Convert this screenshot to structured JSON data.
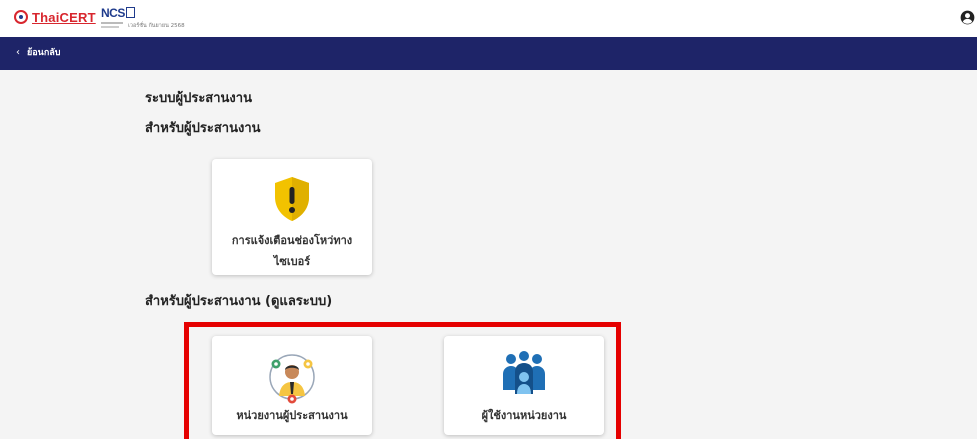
{
  "header": {
    "thaicert_logo_text": "ThaiCERT",
    "ncsa_logo_text": "NCS",
    "ncsa_sub_text": "เวอร์ชั่น กันยายน 2568"
  },
  "navbar": {
    "back_label": "ย้อนกลับ"
  },
  "main": {
    "page_title": "ระบบผู้ประสานงาน",
    "section_coordinator": "สำหรับผู้ประสานงาน",
    "section_admin": "สำหรับผู้ประสานงาน (ดูแลระบบ)",
    "cards": {
      "alert": {
        "line1": "การแจ้งเตือนช่องโหว่ทาง",
        "line2": "ไซเบอร์"
      },
      "agency": {
        "label": "หน่วยงานผู้ประสานงาน"
      },
      "users": {
        "label": "ผู้ใช้งานหน่วยงาน"
      }
    }
  },
  "colors": {
    "navbar": "#1e2468",
    "highlight": "#e50000",
    "shield": "#f2c200",
    "users_icon": "#1f6fb5"
  }
}
